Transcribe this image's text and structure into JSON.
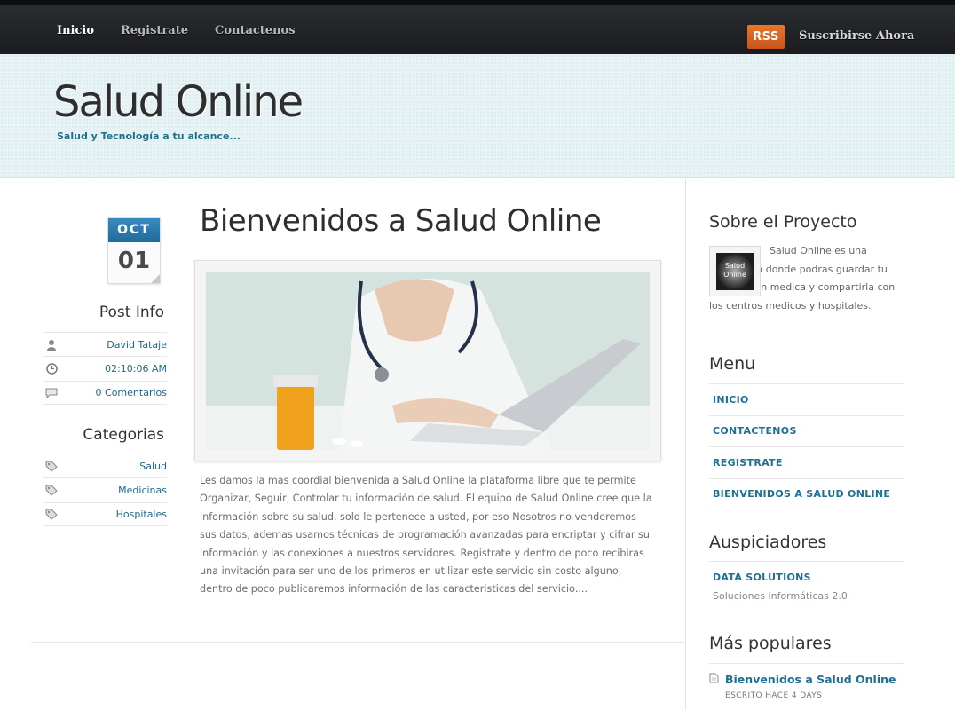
{
  "nav": {
    "items": [
      {
        "label": "Inicio"
      },
      {
        "label": "Registrate"
      },
      {
        "label": "Contactenos"
      }
    ],
    "rss_label": "RSS",
    "subscribe_label": "Suscribirse Ahora"
  },
  "header": {
    "title": "Salud Online",
    "tagline": "Salud y Tecnología a tu alcance..."
  },
  "post": {
    "date_month": "OCT",
    "date_day": "01",
    "title": "Bienvenidos a Salud Online",
    "body": "Les damos la mas coordial bienvenida a Salud Online la plataforma libre que te permite Organizar, Seguir, Controlar tu información de salud. El equipo de Salud Online cree que la información sobre su salud, solo le pertenece a usted, por eso Nosotros no venderemos sus datos, ademas usamos técnicas de programación avanzadas para encriptar y cifrar su información y las conexiones a nuestros servidores. Registrate y dentro de poco recibiras una invitación para ser uno de los primeros en utilizar este servicio sin costo alguno, dentro de poco publicaremos información de las caracteristicas del servicio...."
  },
  "post_info": {
    "heading": "Post Info",
    "author": "David Tataje",
    "time": "02:10:06 AM",
    "comments": "0 Comentarios"
  },
  "categories": {
    "heading": "Categorias",
    "items": [
      "Salud",
      "Medicinas",
      "Hospitales"
    ]
  },
  "sidebar": {
    "about_heading": "Sobre el Proyecto",
    "about_thumb_text": "Salud Online",
    "about_text": "Salud Online es una plataforma donde podras guardar tu información medica y compartirla con los centros medicos y hospitales.",
    "menu_heading": "Menu",
    "menu_items": [
      "INICIO",
      "CONTACTENOS",
      "REGISTRATE",
      "BIENVENIDOS A SALUD ONLINE"
    ],
    "sponsors_heading": "Auspiciadores",
    "sponsor_name": "DATA SOLUTIONS",
    "sponsor_desc": "Soluciones informáticas 2.0",
    "popular_heading": "Más populares",
    "popular_title": "Bienvenidos a Salud Online",
    "popular_meta": "ESCRITO HACE 4 DAYS"
  },
  "icons": {
    "author": "user-icon",
    "time": "clock-icon",
    "comments": "comment-icon",
    "category": "tag-icon",
    "popular": "document-icon"
  },
  "colors": {
    "link": "#1d6f93",
    "rss": "#e06b22",
    "nav_bg": "#1f2124",
    "header_bg": "#e8f3f6"
  }
}
